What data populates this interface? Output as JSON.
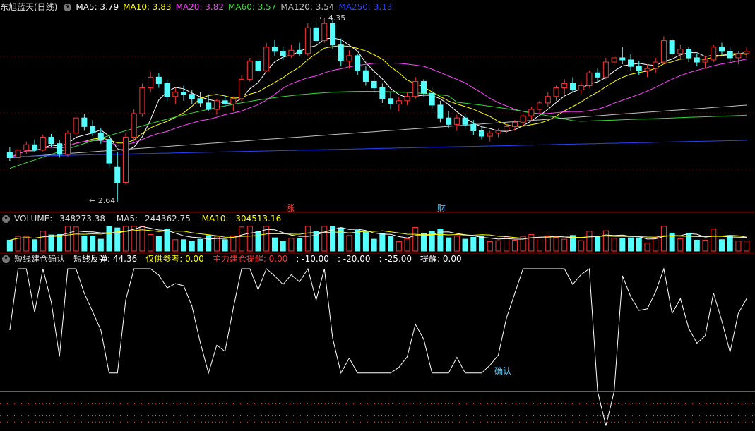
{
  "main": {
    "title": "东旭蓝天(日线)",
    "ma": [
      {
        "label": "MA5:",
        "value": "3.79",
        "color": "#ffffff"
      },
      {
        "label": "MA10:",
        "value": "3.83",
        "color": "#ffff00"
      },
      {
        "label": "MA20:",
        "value": "3.82",
        "color": "#ff44ff"
      },
      {
        "label": "MA60:",
        "value": "3.57",
        "color": "#33dd33"
      },
      {
        "label": "MA120:",
        "value": "3.54",
        "color": "#c0c0c0"
      },
      {
        "label": "MA250:",
        "value": "3.13",
        "color": "#2244ff"
      }
    ],
    "high_label": "4.35",
    "low_label": "2.64",
    "marker_zhang": "涨",
    "marker_cai": "财"
  },
  "volume": {
    "label": "VOLUME:",
    "value": "348273.38",
    "ma5_label": "MA5:",
    "ma5": "244362.75",
    "ma10_label": "MA10:",
    "ma10": "304513.16"
  },
  "indicator": {
    "name": "短线建仓确认",
    "items": [
      {
        "text": "短线反弹: 44.36",
        "color": "#ffffff"
      },
      {
        "text": "仅供参考: 0.00",
        "color": "#ffff00"
      },
      {
        "text": "主力建仓提醒: 0.00",
        "color": "#ff3333"
      },
      {
        "text": ": -10.00",
        "color": "#ffffff"
      },
      {
        "text": ": -20.00",
        "color": "#ffffff"
      },
      {
        "text": ": -25.00",
        "color": "#ffffff"
      },
      {
        "text": "提醒: 0.00",
        "color": "#ffffff"
      }
    ],
    "confirm_label": "确认"
  },
  "chart_data": {
    "type": "candlestick",
    "price_range": [
      2.6,
      4.4
    ],
    "candles": [
      [
        3.1,
        3.15,
        3.02,
        3.05
      ],
      [
        3.05,
        3.14,
        3.0,
        3.12
      ],
      [
        3.12,
        3.2,
        3.08,
        3.17
      ],
      [
        3.17,
        3.22,
        3.1,
        3.12
      ],
      [
        3.12,
        3.26,
        3.11,
        3.24
      ],
      [
        3.24,
        3.27,
        3.15,
        3.18
      ],
      [
        3.18,
        3.21,
        3.05,
        3.08
      ],
      [
        3.08,
        3.3,
        3.06,
        3.28
      ],
      [
        3.28,
        3.45,
        3.25,
        3.42
      ],
      [
        3.42,
        3.46,
        3.3,
        3.34
      ],
      [
        3.34,
        3.4,
        3.25,
        3.28
      ],
      [
        3.28,
        3.33,
        3.18,
        3.22
      ],
      [
        3.22,
        3.24,
        2.96,
        3.0
      ],
      [
        2.96,
        3.1,
        2.64,
        2.82
      ],
      [
        2.82,
        3.28,
        2.8,
        3.24
      ],
      [
        3.24,
        3.5,
        3.2,
        3.46
      ],
      [
        3.46,
        3.74,
        3.43,
        3.7
      ],
      [
        3.7,
        3.85,
        3.66,
        3.8
      ],
      [
        3.8,
        3.84,
        3.7,
        3.74
      ],
      [
        3.74,
        3.78,
        3.58,
        3.62
      ],
      [
        3.62,
        3.7,
        3.55,
        3.66
      ],
      [
        3.66,
        3.72,
        3.58,
        3.64
      ],
      [
        3.64,
        3.68,
        3.55,
        3.6
      ],
      [
        3.6,
        3.66,
        3.52,
        3.56
      ],
      [
        3.56,
        3.64,
        3.48,
        3.5
      ],
      [
        3.5,
        3.6,
        3.45,
        3.58
      ],
      [
        3.58,
        3.63,
        3.52,
        3.55
      ],
      [
        3.55,
        3.62,
        3.48,
        3.6
      ],
      [
        3.6,
        3.82,
        3.58,
        3.78
      ],
      [
        3.78,
        3.98,
        3.76,
        3.95
      ],
      [
        3.95,
        4.02,
        3.82,
        3.86
      ],
      [
        3.86,
        4.12,
        3.85,
        4.08
      ],
      [
        4.08,
        4.15,
        4.0,
        4.04
      ],
      [
        4.04,
        4.08,
        3.96,
        4.0
      ],
      [
        4.0,
        4.1,
        3.98,
        4.05
      ],
      [
        4.05,
        4.12,
        4.0,
        4.02
      ],
      [
        4.02,
        4.3,
        4.0,
        4.26
      ],
      [
        4.26,
        4.32,
        4.1,
        4.14
      ],
      [
        4.14,
        4.35,
        4.12,
        4.3
      ],
      [
        4.3,
        4.34,
        4.06,
        4.1
      ],
      [
        4.1,
        4.16,
        3.9,
        3.95
      ],
      [
        3.95,
        4.05,
        3.88,
        4.0
      ],
      [
        4.0,
        4.02,
        3.82,
        3.86
      ],
      [
        3.86,
        3.9,
        3.72,
        3.76
      ],
      [
        3.76,
        3.82,
        3.65,
        3.7
      ],
      [
        3.7,
        3.74,
        3.56,
        3.6
      ],
      [
        3.6,
        3.66,
        3.5,
        3.55
      ],
      [
        3.55,
        3.62,
        3.48,
        3.58
      ],
      [
        3.58,
        3.66,
        3.54,
        3.62
      ],
      [
        3.62,
        3.8,
        3.6,
        3.76
      ],
      [
        3.76,
        3.78,
        3.62,
        3.65
      ],
      [
        3.65,
        3.7,
        3.5,
        3.54
      ],
      [
        3.54,
        3.58,
        3.38,
        3.42
      ],
      [
        3.42,
        3.48,
        3.33,
        3.36
      ],
      [
        3.36,
        3.45,
        3.3,
        3.42
      ],
      [
        3.42,
        3.46,
        3.32,
        3.36
      ],
      [
        3.36,
        3.4,
        3.26,
        3.3
      ],
      [
        3.3,
        3.34,
        3.22,
        3.25
      ],
      [
        3.25,
        3.3,
        3.2,
        3.28
      ],
      [
        3.28,
        3.32,
        3.24,
        3.3
      ],
      [
        3.3,
        3.36,
        3.28,
        3.34
      ],
      [
        3.34,
        3.4,
        3.3,
        3.38
      ],
      [
        3.38,
        3.46,
        3.35,
        3.44
      ],
      [
        3.44,
        3.52,
        3.4,
        3.5
      ],
      [
        3.5,
        3.58,
        3.46,
        3.56
      ],
      [
        3.56,
        3.66,
        3.52,
        3.62
      ],
      [
        3.62,
        3.72,
        3.58,
        3.7
      ],
      [
        3.7,
        3.78,
        3.64,
        3.74
      ],
      [
        3.74,
        3.8,
        3.66,
        3.68
      ],
      [
        3.68,
        3.76,
        3.64,
        3.72
      ],
      [
        3.72,
        3.86,
        3.7,
        3.84
      ],
      [
        3.84,
        3.88,
        3.76,
        3.8
      ],
      [
        3.8,
        3.98,
        3.78,
        3.94
      ],
      [
        3.94,
        4.04,
        3.9,
        3.98
      ],
      [
        3.98,
        4.08,
        3.92,
        3.96
      ],
      [
        3.96,
        4.02,
        3.86,
        3.9
      ],
      [
        3.9,
        3.95,
        3.82,
        3.86
      ],
      [
        3.86,
        3.92,
        3.8,
        3.88
      ],
      [
        3.88,
        3.98,
        3.84,
        3.94
      ],
      [
        3.94,
        4.18,
        3.92,
        4.14
      ],
      [
        4.14,
        4.16,
        3.98,
        4.02
      ],
      [
        4.02,
        4.1,
        3.96,
        4.06
      ],
      [
        4.06,
        4.08,
        3.94,
        3.98
      ],
      [
        3.98,
        4.02,
        3.9,
        3.94
      ],
      [
        3.94,
        4.0,
        3.88,
        3.96
      ],
      [
        3.96,
        4.1,
        3.94,
        4.08
      ],
      [
        4.08,
        4.12,
        4.0,
        4.04
      ],
      [
        4.04,
        4.08,
        3.94,
        3.98
      ],
      [
        3.98,
        4.04,
        3.92,
        4.02
      ],
      [
        4.02,
        4.08,
        3.98,
        4.04
      ]
    ],
    "volume_max": 500000,
    "indicator_range": [
      -30,
      100
    ]
  }
}
